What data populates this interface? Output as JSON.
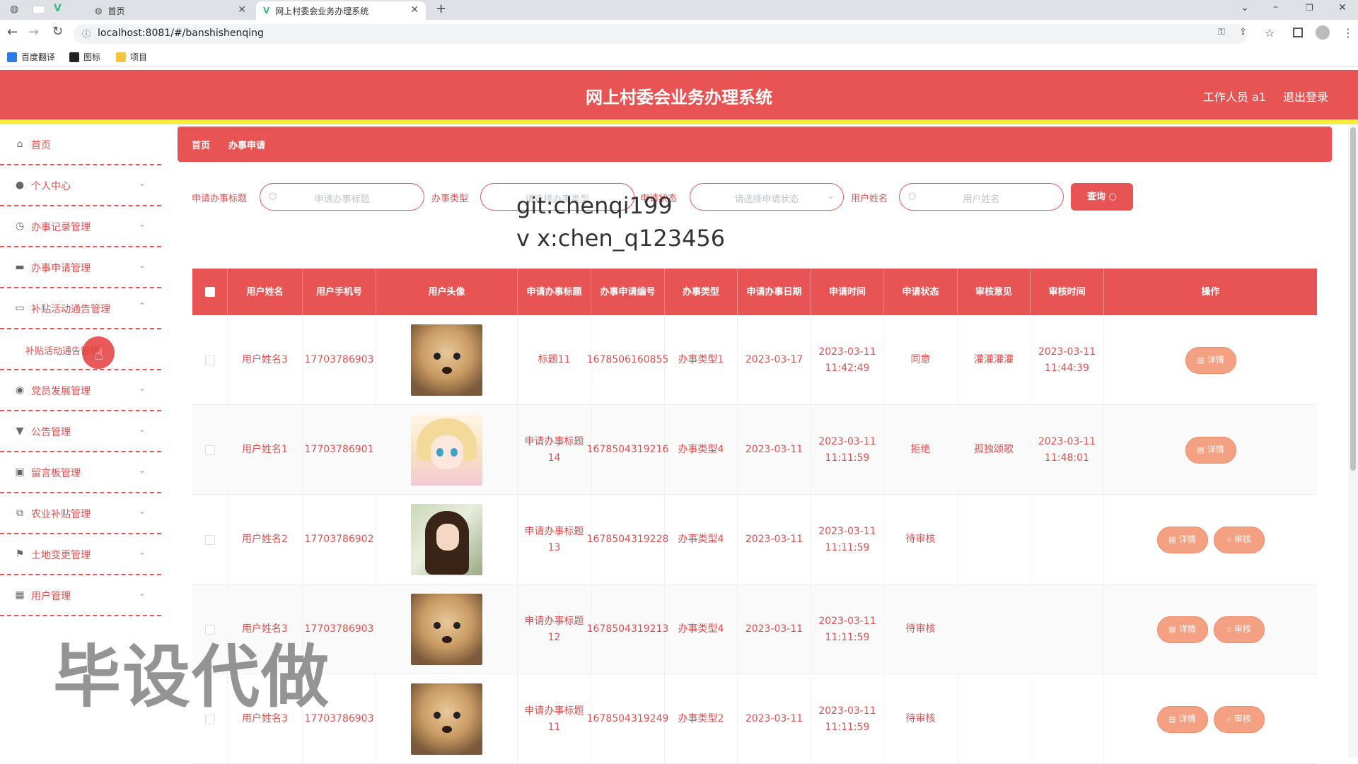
{
  "browser": {
    "tabs": [
      {
        "label": "首页",
        "icon": "globe-icon"
      },
      {
        "label": "网上村委会业务办理系统",
        "icon": "vue-icon"
      }
    ],
    "url": "localhost:8081/#/banshishenqing",
    "bookmarks": [
      {
        "label": "百度翻译",
        "icon": "translate-icon",
        "color": "#2d7be5"
      },
      {
        "label": "图标",
        "icon": "image-icon",
        "color": "#222222"
      },
      {
        "label": "项目",
        "icon": "folder-icon",
        "color": "#f5c542"
      }
    ]
  },
  "header": {
    "title": "网上村委会业务办理系统",
    "user": "工作人员 a1",
    "logout": "退出登录",
    "accent": "#e85353",
    "stripe": "#f6ee3a"
  },
  "sidebar": {
    "items": [
      {
        "label": "首页",
        "icon": "home-icon",
        "expandable": false
      },
      {
        "label": "个人中心",
        "icon": "user-icon",
        "expandable": true
      },
      {
        "label": "办事记录管理",
        "icon": "clock-icon",
        "expandable": true
      },
      {
        "label": "办事申请管理",
        "icon": "ticket-icon",
        "expandable": true
      },
      {
        "label": "补贴活动通告管理",
        "icon": "monitor-icon",
        "expandable": true,
        "expanded": true
      },
      {
        "label": "党员发展管理",
        "icon": "pin-icon",
        "expandable": true
      },
      {
        "label": "公告管理",
        "icon": "podium-icon",
        "expandable": true
      },
      {
        "label": "留言板管理",
        "icon": "clipboard-icon",
        "expandable": true
      },
      {
        "label": "农业补贴管理",
        "icon": "copy-icon",
        "expandable": true
      },
      {
        "label": "土地变更管理",
        "icon": "flag-icon",
        "expandable": true
      },
      {
        "label": "用户管理",
        "icon": "trash-icon",
        "expandable": true
      }
    ],
    "sub_item": "补贴活动通告管理"
  },
  "breadcrumb": {
    "home": "首页",
    "current": "办事申请"
  },
  "search": {
    "title_label": "申请办事标题",
    "title_placeholder": "申请办事标题",
    "type_label": "办事类型",
    "type_placeholder": "请选择办事类型",
    "status_label": "申请状态",
    "status_placeholder": "请选择申请状态",
    "name_label": "用户姓名",
    "name_placeholder": "用户姓名",
    "query_button": "查询"
  },
  "watermarks": {
    "line1": "git:chenqi199",
    "line2": "v x:chen_q123456",
    "big": "毕设代做"
  },
  "table": {
    "columns": [
      "用户姓名",
      "用户手机号",
      "用户头像",
      "申请办事标题",
      "办事申请编号",
      "办事类型",
      "申请办事日期",
      "申请时间",
      "申请状态",
      "审核意见",
      "审核时间",
      "操作"
    ],
    "detail_label": "详情",
    "review_label": "审核",
    "rows": [
      {
        "name": "用户姓名3",
        "phone": "17703786903",
        "avatar": "puppy",
        "title": "标题11",
        "code": "1678506160855",
        "type": "办事类型1",
        "date": "2023-03-17",
        "apply_time": "2023-03-11 11:42:49",
        "status": "同意",
        "opinion": "灌灌灌灌",
        "review_time": "2023-03-11 11:44:39",
        "can_review": false
      },
      {
        "name": "用户姓名1",
        "phone": "17703786901",
        "avatar": "anime-girl",
        "title": "申请办事标题14",
        "code": "1678504319216",
        "type": "办事类型4",
        "date": "2023-03-11",
        "apply_time": "2023-03-11 11:11:59",
        "status": "拒绝",
        "opinion": "孤独颂歌",
        "review_time": "2023-03-11 11:48:01",
        "can_review": false
      },
      {
        "name": "用户姓名2",
        "phone": "17703786902",
        "avatar": "woman",
        "title": "申请办事标题13",
        "code": "1678504319228",
        "type": "办事类型4",
        "date": "2023-03-11",
        "apply_time": "2023-03-11 11:11:59",
        "status": "待审核",
        "opinion": "",
        "review_time": "",
        "can_review": true
      },
      {
        "name": "用户姓名3",
        "phone": "17703786903",
        "avatar": "puppy",
        "title": "申请办事标题12",
        "code": "1678504319213",
        "type": "办事类型4",
        "date": "2023-03-11",
        "apply_time": "2023-03-11 11:11:59",
        "status": "待审核",
        "opinion": "",
        "review_time": "",
        "can_review": true
      },
      {
        "name": "用户姓名3",
        "phone": "17703786903",
        "avatar": "puppy",
        "title": "申请办事标题11",
        "code": "1678504319249",
        "type": "办事类型2",
        "date": "2023-03-11",
        "apply_time": "2023-03-11 11:11:59",
        "status": "待审核",
        "opinion": "",
        "review_time": "",
        "can_review": true
      }
    ]
  }
}
